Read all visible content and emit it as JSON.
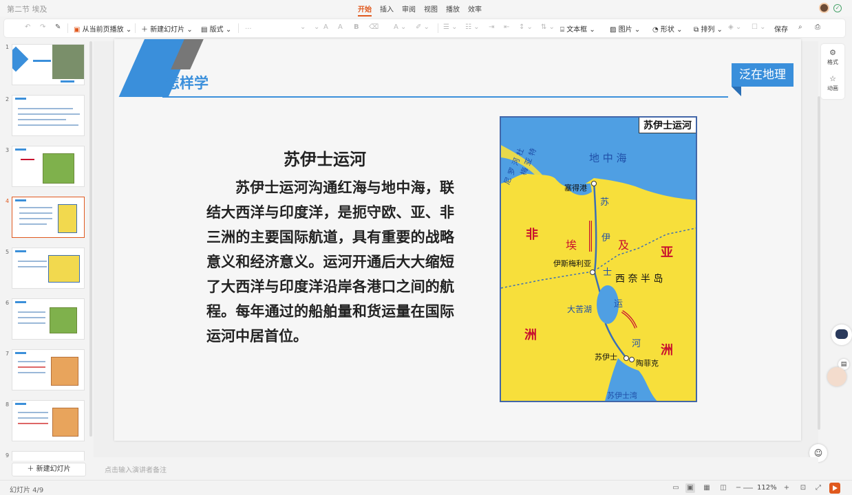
{
  "titlebar": {
    "doc_title": "第二节 埃及",
    "tabs": [
      "开始",
      "插入",
      "审阅",
      "视图",
      "播放",
      "效率"
    ],
    "active_tab": "开始"
  },
  "toolbar": {
    "play_from_current": "从当前页播放",
    "new_slide": "新建幻灯片",
    "layout": "版式",
    "font_placeholder": "...",
    "text_box": "文本框",
    "picture": "图片",
    "shape": "形状",
    "arrange": "排列",
    "save": "保存"
  },
  "slide_panel": {
    "numbers": [
      "1",
      "2",
      "3",
      "4",
      "5",
      "6",
      "7",
      "8",
      "9"
    ],
    "active_index": 4,
    "new_slide_button": "新建幻灯片"
  },
  "slide": {
    "section_title": "怎样学",
    "brand": "泛在地理",
    "article_title": "苏伊士运河",
    "article_body": "苏伊士运河沟通红海与地中海，联结大西洋与印度洋，是扼守欧、亚、非三洲的主要国际航道，具有重要的战略意义和经济意义。运河开通后大大缩短了大西洋与印度洋沿岸各港口之间的航程。每年通过的船舶量和货运量在国际运河中居首位。",
    "map": {
      "title": "苏伊士运河",
      "sea": "地 中 海",
      "port_said": "塞得港",
      "ismailia": "伊斯梅利亚",
      "bitter_lake": "大苦湖",
      "suez": "苏伊士",
      "tawfiq": "陶菲克",
      "gulf": "苏伊士湾",
      "sinai": "西 奈 半 岛",
      "canal_chars": [
        "苏",
        "伊",
        "士",
        "运",
        "河"
      ],
      "nile_chars": [
        "尼",
        "罗",
        "河",
        "杜",
        "梅",
        "亚",
        "特"
      ],
      "continent_left": [
        "非",
        "洲"
      ],
      "country": [
        "埃",
        "及"
      ],
      "continent_right": [
        "亚",
        "洲"
      ],
      "colors": {
        "land": "#f7df3b",
        "water": "#4f9fe3",
        "river": "#3b6fb5",
        "label_red": "#c8102e",
        "label_blue": "#1f4fa8"
      }
    }
  },
  "right_rail": {
    "format": "格式",
    "animation": "动画"
  },
  "notes": {
    "placeholder": "点击输入演讲者备注"
  },
  "statusbar": {
    "slide_indicator": "幻灯片 4/9",
    "zoom": "112%"
  }
}
